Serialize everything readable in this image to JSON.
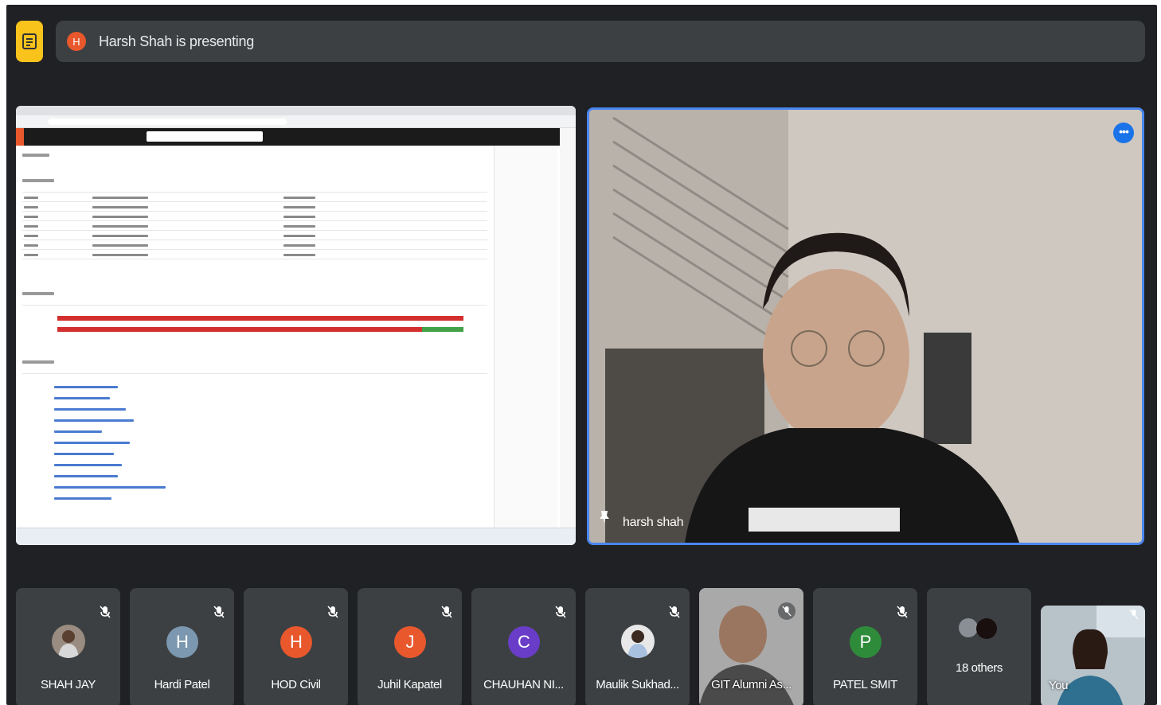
{
  "banner": {
    "presenter_initial": "H",
    "text": "Harsh Shah is presenting"
  },
  "main_speaker": {
    "name": "harsh shah"
  },
  "participants": [
    {
      "name": "SHAH JAY",
      "initial": "",
      "color": "",
      "muted": true,
      "kind": "photo"
    },
    {
      "name": "Hardi Patel",
      "initial": "H",
      "color": "#7c98b0",
      "muted": true,
      "kind": "avatar"
    },
    {
      "name": "HOD Civil",
      "initial": "H",
      "color": "#e8582c",
      "muted": true,
      "kind": "avatar"
    },
    {
      "name": "Juhil Kapatel",
      "initial": "J",
      "color": "#e8582c",
      "muted": true,
      "kind": "avatar"
    },
    {
      "name": "CHAUHAN NI...",
      "initial": "C",
      "color": "#6a3dc8",
      "muted": true,
      "kind": "avatar"
    },
    {
      "name": "Maulik Sukhad...",
      "initial": "",
      "color": "",
      "muted": true,
      "kind": "photo"
    },
    {
      "name": "GIT Alumni As...",
      "initial": "",
      "color": "",
      "muted": true,
      "kind": "video"
    },
    {
      "name": "PATEL SMIT",
      "initial": "P",
      "color": "#2e8b3a",
      "muted": true,
      "kind": "avatar"
    },
    {
      "name": "18 others",
      "initial": "",
      "color": "",
      "muted": false,
      "kind": "group"
    },
    {
      "name": "You",
      "initial": "",
      "color": "",
      "muted": true,
      "kind": "video"
    }
  ],
  "colors": {
    "background": "#202124",
    "tile": "#3c4043",
    "active_border": "#4a86f0",
    "present_icon": "#f9c31c"
  },
  "icons": [
    "present-screen-icon",
    "more-options-icon",
    "pin-icon",
    "mic-off-icon"
  ]
}
